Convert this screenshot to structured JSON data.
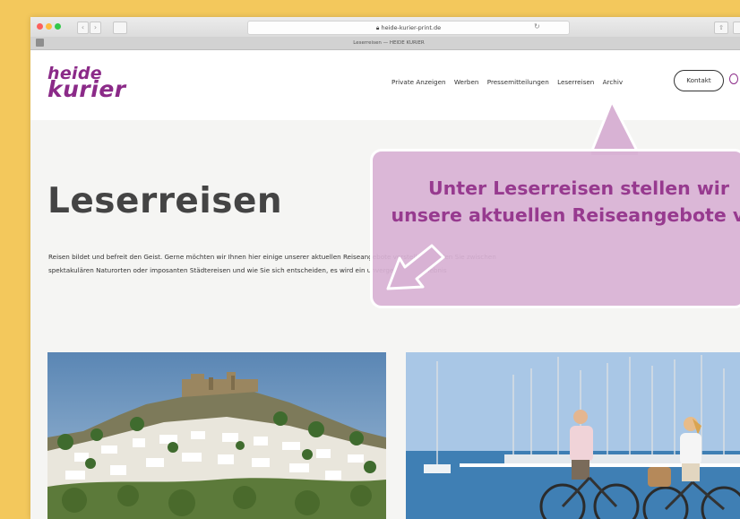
{
  "browser": {
    "url": "heide-kurier-print.de",
    "tab_title": "Leserreisen — HEIDE KURIER"
  },
  "site": {
    "logo_line1": "heide",
    "logo_line2": "kurier",
    "nav": [
      {
        "label": "Private Anzeigen"
      },
      {
        "label": "Werben"
      },
      {
        "label": "Pressemitteilungen"
      },
      {
        "label": "Leserreisen"
      },
      {
        "label": "Archiv"
      }
    ],
    "contact_label": "Kontakt"
  },
  "page": {
    "title": "Leserreisen",
    "intro": "Reisen bildet und befreit den Geist. Gerne möchten wir Ihnen hier einige unserer aktuellen Reiseangebote vorstellen. Wählen Sie zwischen spektakulären Naturorten oder imposanten Städtereisen und wie Sie sich entscheiden, es wird ein unvergessliches Erlebnis"
  },
  "callout": {
    "text": "Unter Leserreisen stellen wir unsere aktuellen Reiseangebote vor"
  },
  "colors": {
    "background": "#f3c85c",
    "brand": "#8b2a88",
    "callout_fill": "#d8b2d4",
    "callout_text": "#973a8f"
  }
}
